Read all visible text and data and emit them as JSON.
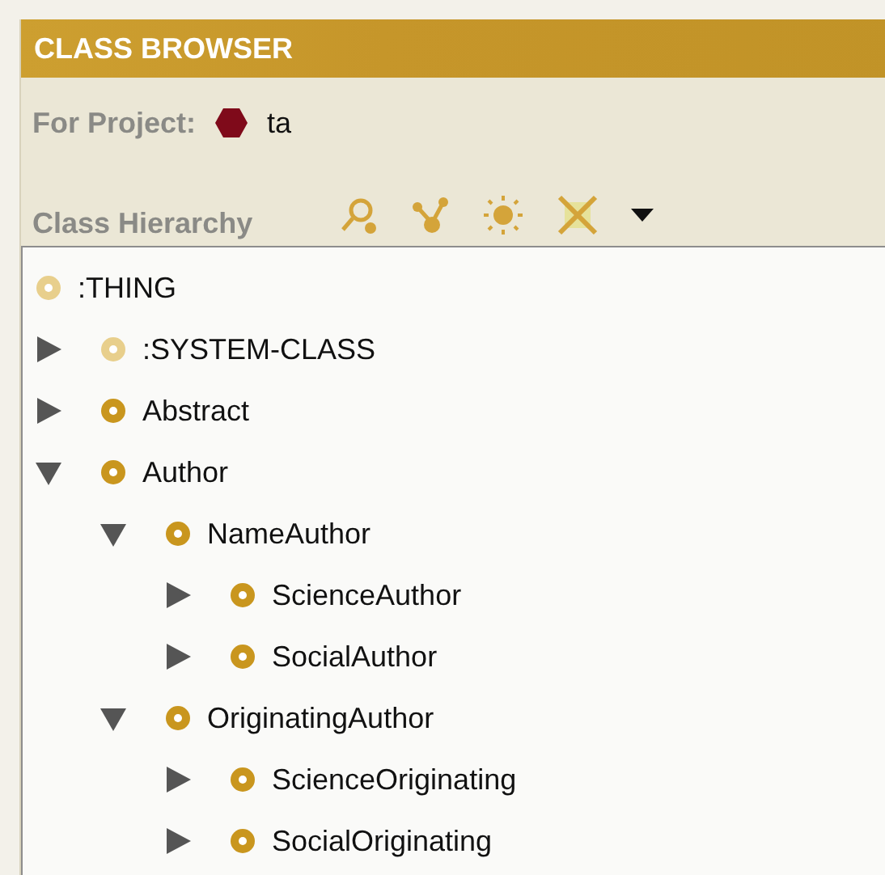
{
  "header": {
    "title": "CLASS BROWSER"
  },
  "project": {
    "label": "For Project:",
    "name": "ta"
  },
  "hierarchy": {
    "title": "Class Hierarchy"
  },
  "tree": {
    "label": ":THING",
    "kind": "system",
    "children": [
      {
        "label": ":SYSTEM-CLASS",
        "kind": "system",
        "expanded": false
      },
      {
        "label": "Abstract",
        "kind": "class",
        "expanded": false
      },
      {
        "label": "Author",
        "kind": "class",
        "expanded": true,
        "children": [
          {
            "label": "NameAuthor",
            "kind": "class",
            "expanded": true,
            "children": [
              {
                "label": "ScienceAuthor",
                "kind": "class",
                "expanded": false
              },
              {
                "label": "SocialAuthor",
                "kind": "class",
                "expanded": false
              }
            ]
          },
          {
            "label": "OriginatingAuthor",
            "kind": "class",
            "expanded": true,
            "children": [
              {
                "label": "ScienceOriginating",
                "kind": "class",
                "expanded": false
              },
              {
                "label": "SocialOriginating",
                "kind": "class",
                "expanded": false
              }
            ]
          }
        ]
      }
    ]
  }
}
